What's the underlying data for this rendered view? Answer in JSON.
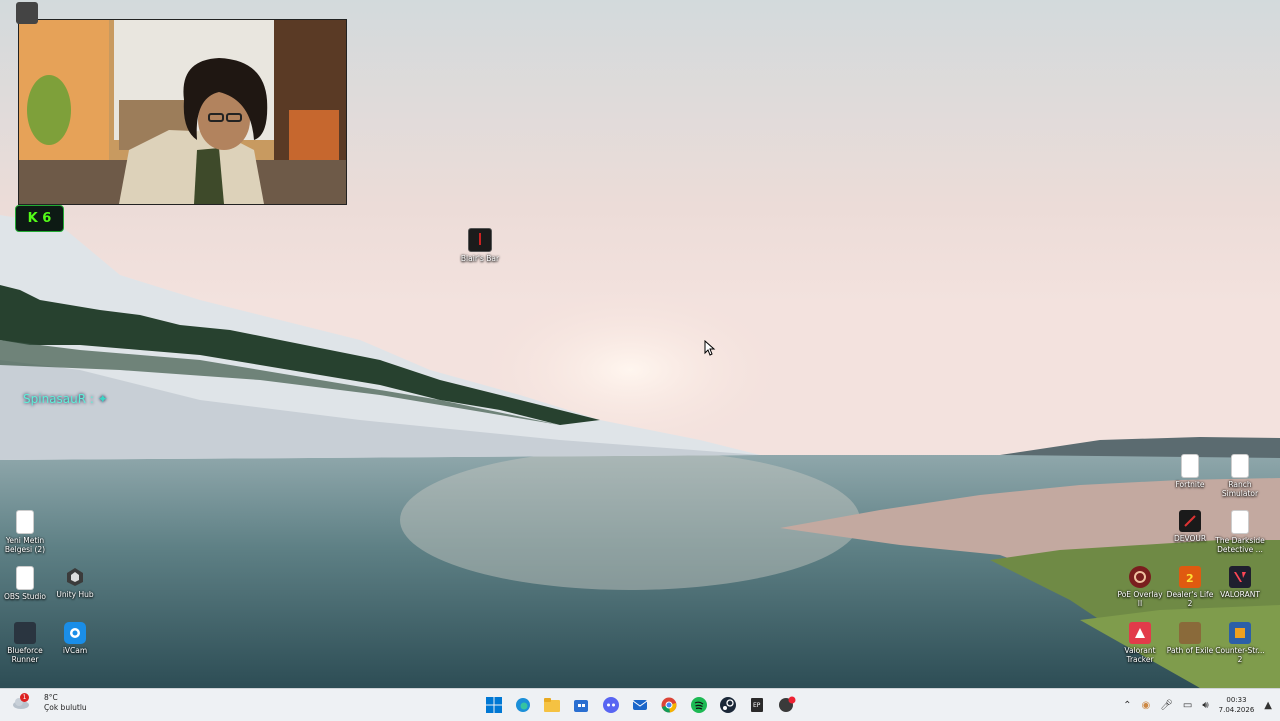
{
  "desktop": {
    "center_icon": {
      "label": "Blair's Bar"
    },
    "left_icons": [
      {
        "label": "Yeni Metin Belgesi (2)"
      },
      {
        "label": "OBS Studio"
      },
      {
        "label": "Unity Hub"
      },
      {
        "label": "Blueforce Runner"
      },
      {
        "label": "iVCam"
      }
    ],
    "right_icons": [
      {
        "label": "Fortnite"
      },
      {
        "label": "Ranch Simulator"
      },
      {
        "label": "DEVOUR"
      },
      {
        "label": "The Darkside Detective ..."
      },
      {
        "label": "PoE Overlay II"
      },
      {
        "label": "Dealer's Life 2"
      },
      {
        "label": "VALORANT"
      },
      {
        "label": "Valorant Tracker"
      },
      {
        "label": "Path of Exile"
      },
      {
        "label": "Counter-Str... 2"
      }
    ]
  },
  "overlay": {
    "badge_text": "K 6",
    "chat_text": "SpinasauR :"
  },
  "taskbar": {
    "weather_temp": "8°C",
    "weather_desc": "Çok bulutlu",
    "weather_alert": "1",
    "apps": [
      "start",
      "edge",
      "file-explorer",
      "microsoft-store",
      "discord",
      "mail",
      "chrome",
      "spotify",
      "steam",
      "epic-games",
      "app-red"
    ],
    "time": "00:33",
    "date": "7.04.2026"
  },
  "colors": {
    "accent": "#0078d4",
    "kick_green": "#53fc18",
    "chat_cyan": "#5ff0d8"
  }
}
